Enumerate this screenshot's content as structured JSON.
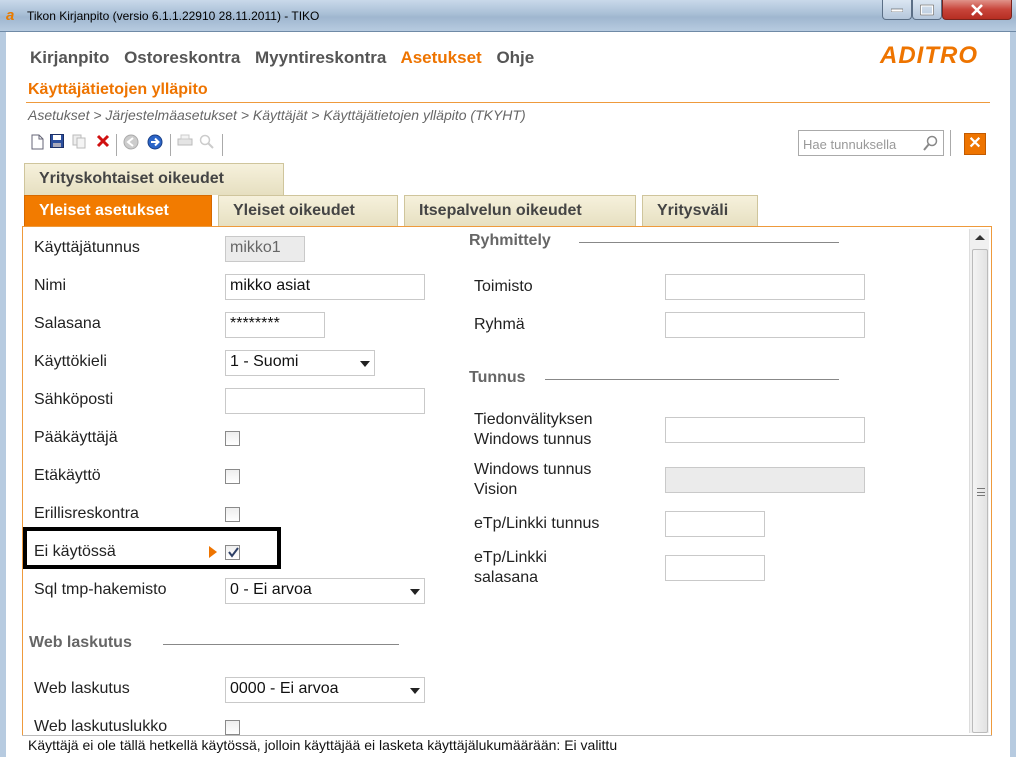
{
  "window": {
    "title": "Tikon Kirjanpito (versio 6.1.1.22910 28.11.2011) - TIKO"
  },
  "menu": {
    "items": [
      {
        "label": "Kirjanpito",
        "active": false
      },
      {
        "label": "Ostoreskontra",
        "active": false
      },
      {
        "label": "Myyntireskontra",
        "active": false
      },
      {
        "label": "Asetukset",
        "active": true
      },
      {
        "label": "Ohje",
        "active": false
      }
    ],
    "logo": "ADITRO"
  },
  "page": {
    "title": "Käyttäjätietojen ylläpito",
    "breadcrumb": "Asetukset > Järjestelmäasetukset > Käyttäjät > Käyttäjätietojen ylläpito  (TKYHT)"
  },
  "toolbar": {
    "search_placeholder": "Hae tunnuksella",
    "icons": [
      "new-document-icon",
      "save-icon",
      "copy-icon",
      "delete-icon",
      "back-icon",
      "forward-icon",
      "print-icon",
      "preview-icon"
    ],
    "close_label": "✕"
  },
  "tabs": {
    "top": "Yrityskohtaiset oikeudet",
    "items": [
      {
        "label": "Yleiset asetukset",
        "active": true
      },
      {
        "label": "Yleiset oikeudet",
        "active": false
      },
      {
        "label": "Itsepalvelun oikeudet",
        "active": false
      },
      {
        "label": "Yritysväli",
        "active": false
      }
    ]
  },
  "form": {
    "kayttajatunnus": {
      "label": "Käyttäjätunnus",
      "value": "mikko1"
    },
    "nimi": {
      "label": "Nimi",
      "value": "mikko asiat"
    },
    "salasana": {
      "label": "Salasana",
      "value": "********"
    },
    "kayttokieli": {
      "label": "Käyttökieli",
      "value": "1 - Suomi"
    },
    "sahkoposti": {
      "label": "Sähköposti",
      "value": ""
    },
    "paakayttaja": {
      "label": "Pääkäyttäjä",
      "checked": false
    },
    "etakaytto": {
      "label": "Etäkäyttö",
      "checked": false
    },
    "erillisreskontra": {
      "label": "Erillisreskontra",
      "checked": false
    },
    "ei_kaytossa": {
      "label": "Ei käytössä",
      "checked": true
    },
    "sql_tmp": {
      "label": "Sql tmp-hakemisto",
      "value": "0  -  Ei arvoa"
    },
    "web_group": "Web laskutus",
    "web_laskutus": {
      "label": "Web laskutus",
      "value": "0000 - Ei arvoa"
    },
    "web_laskutuslukko": {
      "label": "Web laskutuslukko",
      "checked": false
    },
    "ryhmittely_group": "Ryhmittely",
    "toimisto": {
      "label": "Toimisto",
      "value": ""
    },
    "ryhma": {
      "label": "Ryhmä",
      "value": ""
    },
    "tunnus_group": "Tunnus",
    "tiedonvalitys": {
      "label_line1": "Tiedonvälityksen",
      "label_line2": "Windows tunnus",
      "value": ""
    },
    "windows_vision": {
      "label_line1": "Windows tunnus",
      "label_line2": "Vision",
      "value": ""
    },
    "etp_tunnus": {
      "label": "eTp/Linkki tunnus",
      "value": ""
    },
    "etp_salasana": {
      "label_line1": "eTp/Linkki",
      "label_line2": "salasana",
      "value": ""
    }
  },
  "status": "Käyttäjä ei ole tällä hetkellä käytössä, jolloin käyttäjää ei lasketa käyttäjälukumäärään: Ei valittu",
  "colors": {
    "accent": "#ee7400",
    "tab_bg": "#e6dfc0"
  }
}
